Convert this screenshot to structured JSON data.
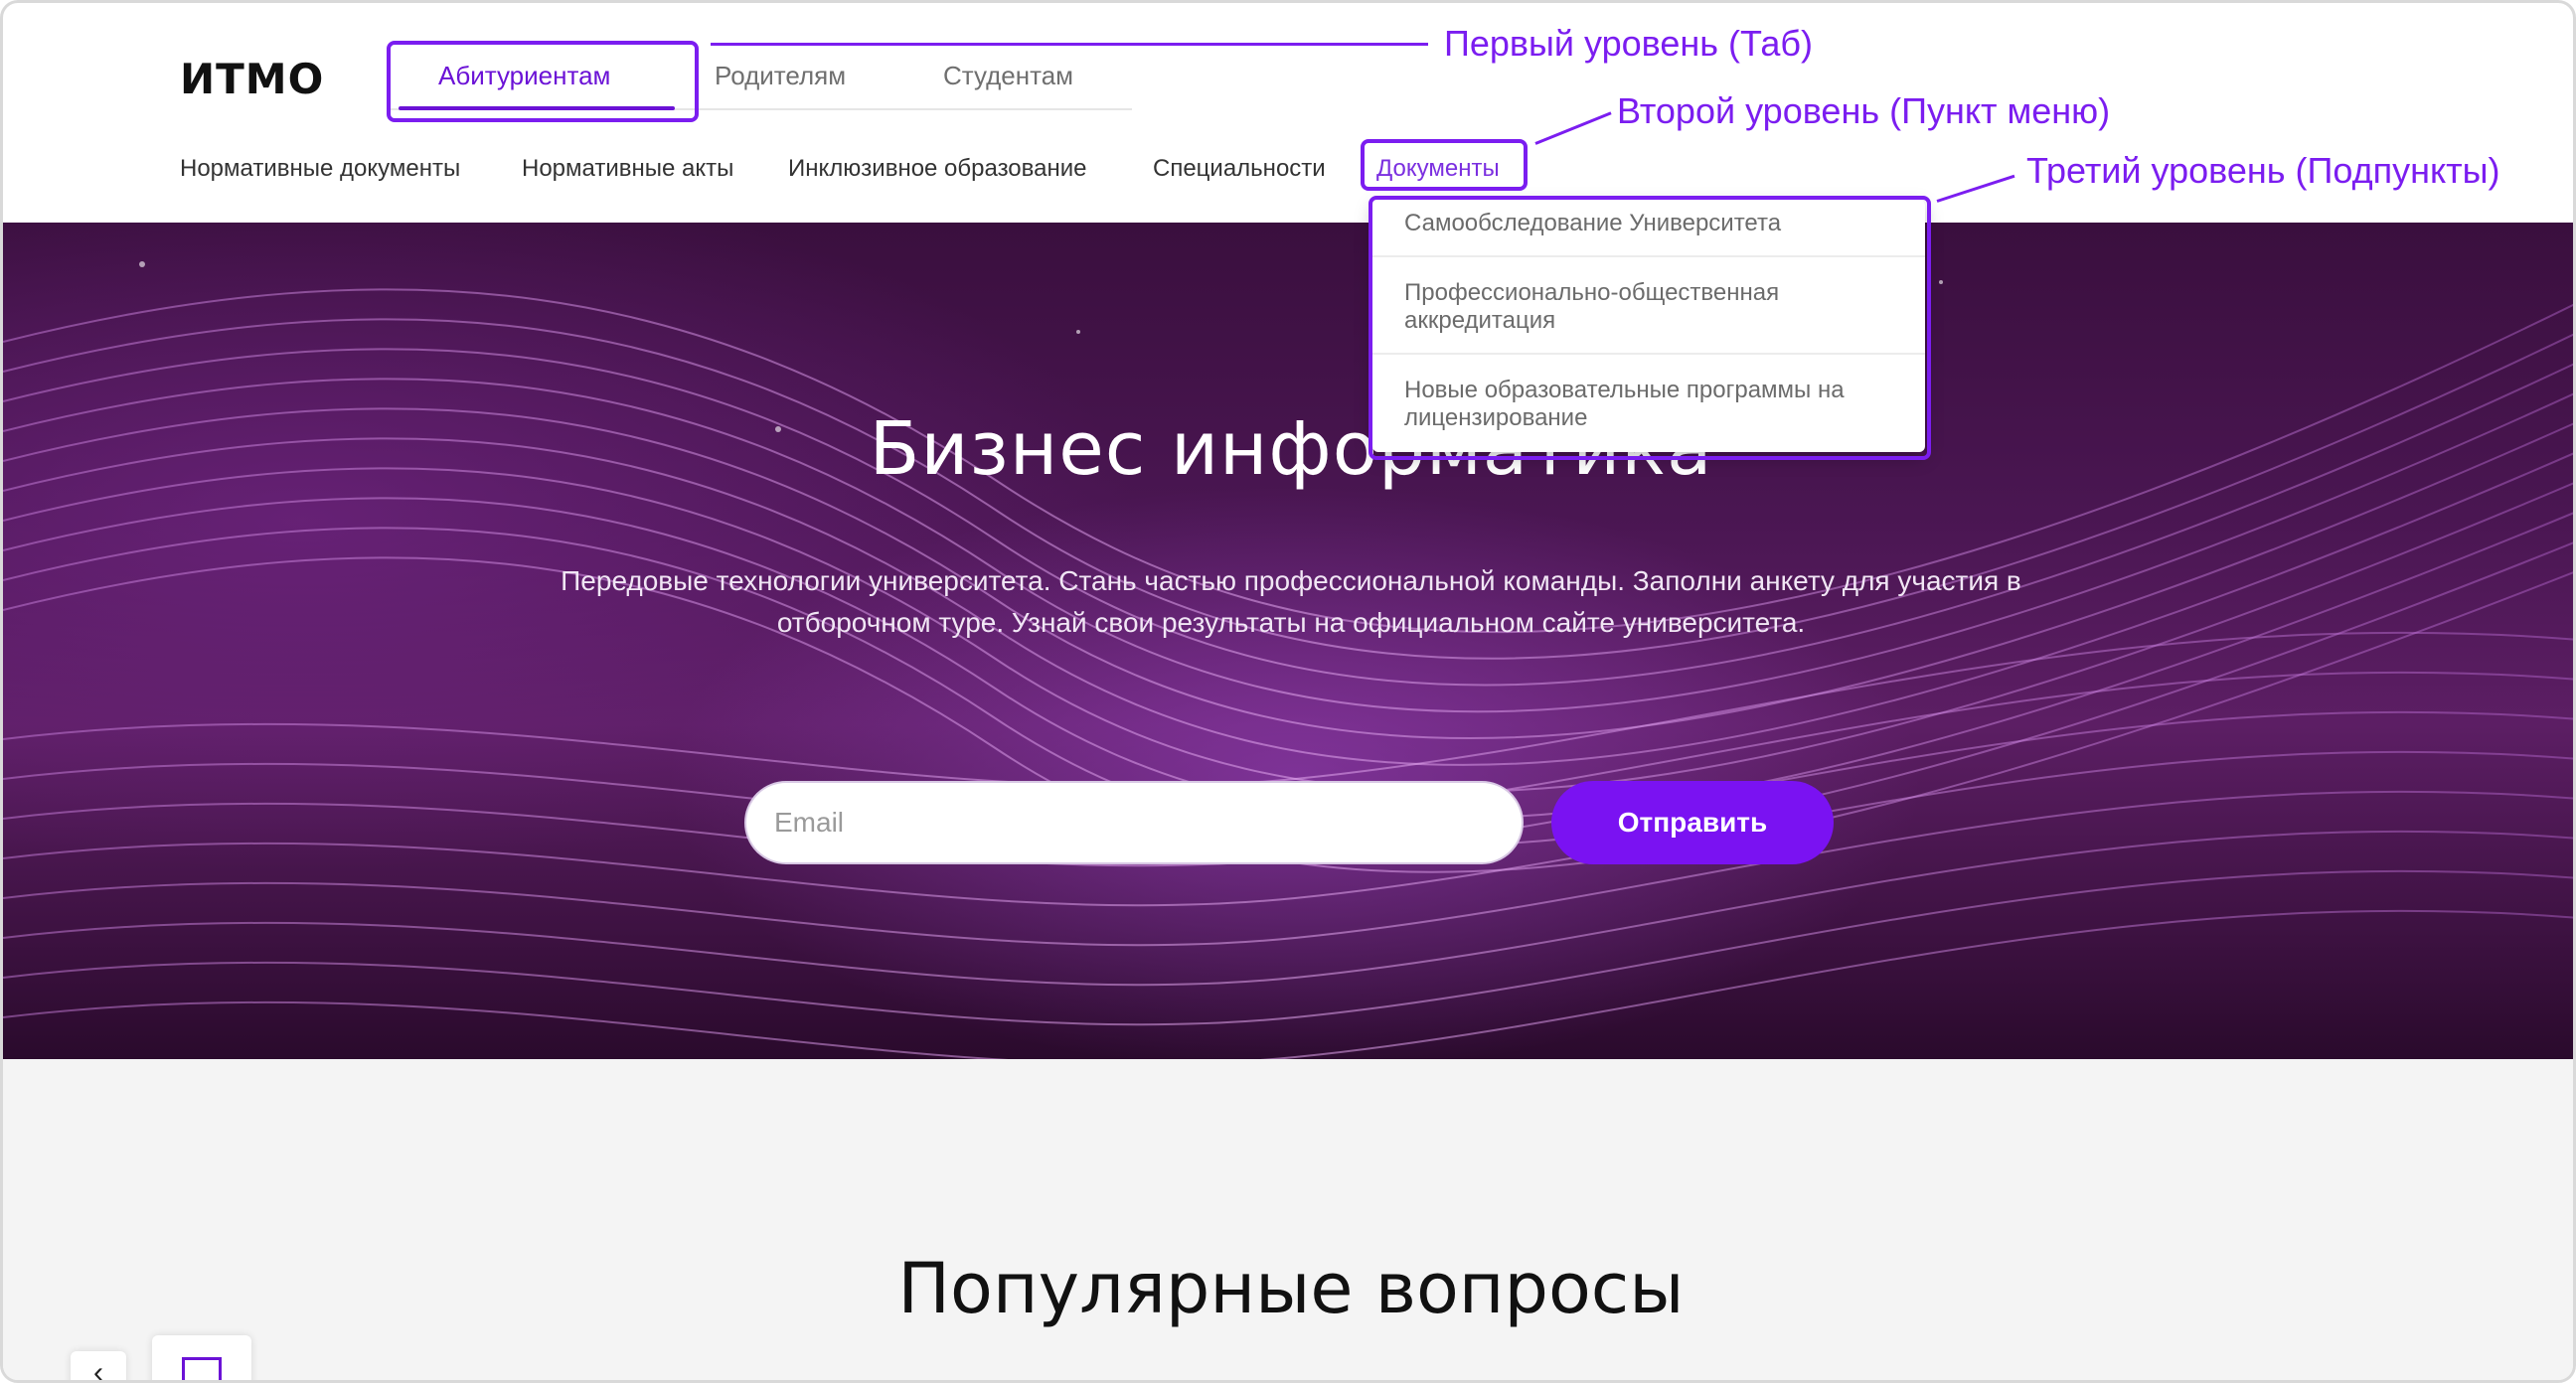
{
  "header": {
    "logo": "ИТМО",
    "tabs": [
      {
        "label": "Абитуриентам",
        "active": true
      },
      {
        "label": "Родителям",
        "active": false
      },
      {
        "label": "Студентам",
        "active": false
      }
    ],
    "nav": [
      {
        "label": "Нормативные документы"
      },
      {
        "label": "Нормативные акты"
      },
      {
        "label": "Инклюзивное образование"
      },
      {
        "label": "Специальности"
      },
      {
        "label": "Документы",
        "active": true
      }
    ]
  },
  "dropdown": {
    "items": [
      {
        "label": "Самообследование Университета"
      },
      {
        "label": "Профессионально-общественная аккредитация"
      },
      {
        "label": "Новые образовательные программы на лицензирование"
      }
    ]
  },
  "annotations": {
    "level1": "Первый уровень (Таб)",
    "level2": "Второй уровень (Пункт меню)",
    "level3": "Третий уровень (Подпункты)"
  },
  "hero": {
    "title": "Бизнес информатика",
    "text": "Передовые технологии университета. Стань частью профессиональной команды. Заполни анкету для участия в отборочном туре. Узнай свои результаты на официальном сайте университета.",
    "email_placeholder": "Email",
    "email_value": "",
    "submit_label": "Отправить"
  },
  "faq": {
    "title": "Популярные вопросы"
  },
  "colors": {
    "accent": "#7a12f2",
    "annotation": "#7b1df0",
    "hero_dark": "#3a0f3e"
  },
  "icons": {
    "back": "chevron-left-icon",
    "widget": "square-icon"
  }
}
